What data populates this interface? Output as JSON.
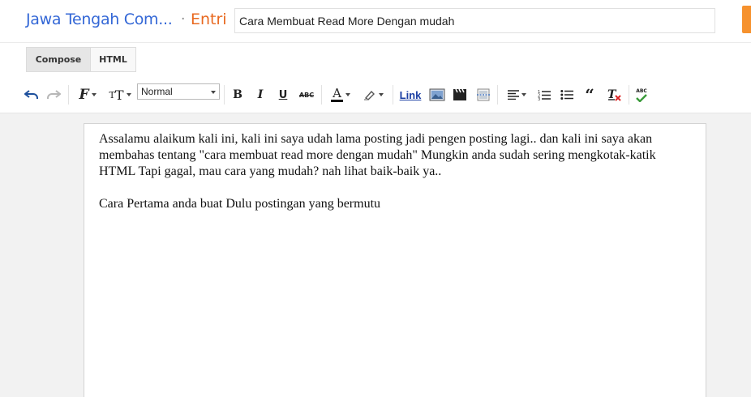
{
  "header": {
    "blog_title": "Jawa Tengah Com...",
    "separator": "·",
    "crumb": "Entri",
    "post_title_value": "Cara Membuat Read More Dengan mudah"
  },
  "mode_tabs": [
    {
      "label": "Compose",
      "active": true
    },
    {
      "label": "HTML",
      "active": false
    }
  ],
  "toolbar": {
    "paragraph_style": "Normal",
    "bold_label": "B",
    "italic_label": "I",
    "underline_label": "U",
    "strike_label": "ABC",
    "text_color_label": "A",
    "link_label": "Link",
    "spellcheck_label": "ABC",
    "icons": [
      "undo-icon",
      "redo-icon",
      "font-family-icon",
      "font-size-icon",
      "bold-icon",
      "italic-icon",
      "underline-icon",
      "strikethrough-icon",
      "text-color-icon",
      "highlight-icon",
      "image-icon",
      "video-icon",
      "jump-break-icon",
      "align-icon",
      "numbered-list-icon",
      "bullet-list-icon",
      "quote-icon",
      "clear-formatting-icon",
      "spellcheck-icon"
    ]
  },
  "editor": {
    "paragraph_1": "Assalamu alaikum kali ini, kali ini saya udah lama posting jadi pengen posting lagi.. dan kali ini saya akan membahas tentang \"cara membuat read more dengan mudah\" Mungkin anda sudah sering mengkotak-katik HTML Tapi gagal, mau cara yang mudah? nah lihat baik-baik ya..",
    "paragraph_2": "Cara Pertama anda buat Dulu postingan yang bermutu"
  },
  "colors": {
    "blog_title": "#3367d6",
    "crumb": "#e8681f",
    "publish_accent": "#f6922e",
    "editor_bg": "#f2f2f2"
  }
}
